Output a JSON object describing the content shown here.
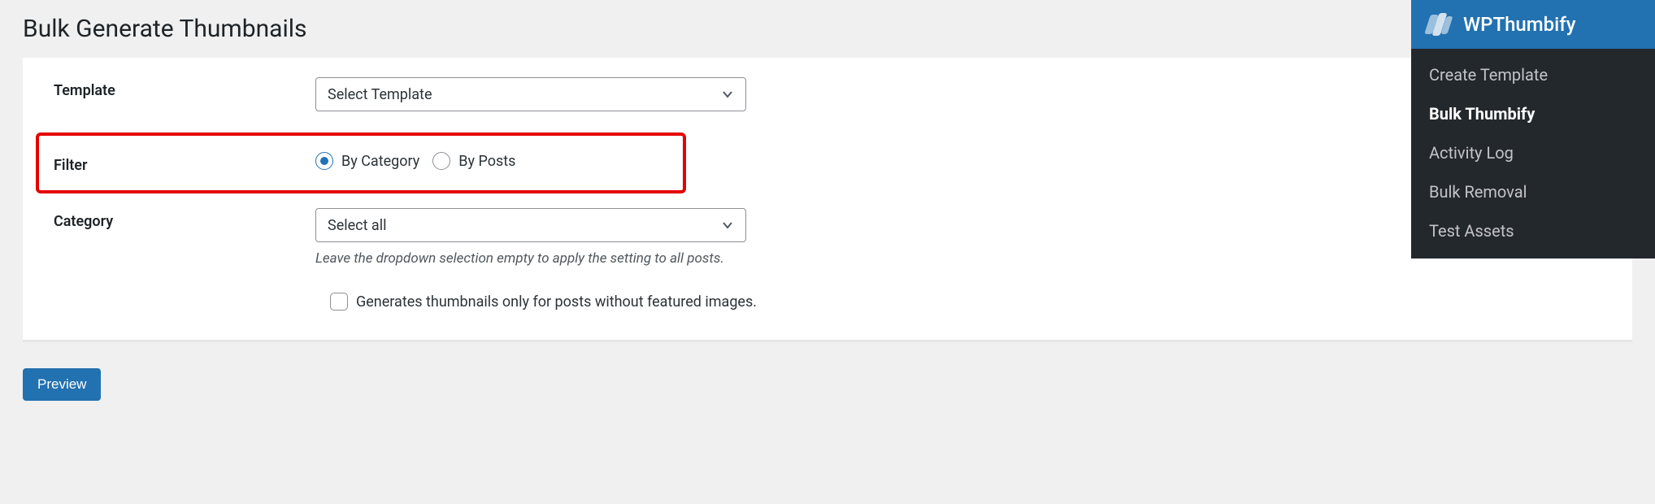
{
  "page": {
    "title": "Bulk Generate Thumbnails"
  },
  "form": {
    "template": {
      "label": "Template",
      "select_placeholder": "Select Template"
    },
    "filter": {
      "label": "Filter",
      "options": {
        "by_category": {
          "label": "By Category",
          "checked": true
        },
        "by_posts": {
          "label": "By Posts",
          "checked": false
        }
      }
    },
    "category": {
      "label": "Category",
      "select_placeholder": "Select all",
      "help": "Leave the dropdown selection empty to apply the setting to all posts."
    },
    "only_without_featured": {
      "label": "Generates thumbnails only for posts without featured images.",
      "checked": false
    },
    "preview_button": "Preview"
  },
  "sidebar": {
    "brand": "WPThumbify",
    "items": [
      {
        "label": "Create Template",
        "active": false
      },
      {
        "label": "Bulk Thumbify",
        "active": true
      },
      {
        "label": "Activity Log",
        "active": false
      },
      {
        "label": "Bulk Removal",
        "active": false
      },
      {
        "label": "Test Assets",
        "active": false
      }
    ]
  }
}
